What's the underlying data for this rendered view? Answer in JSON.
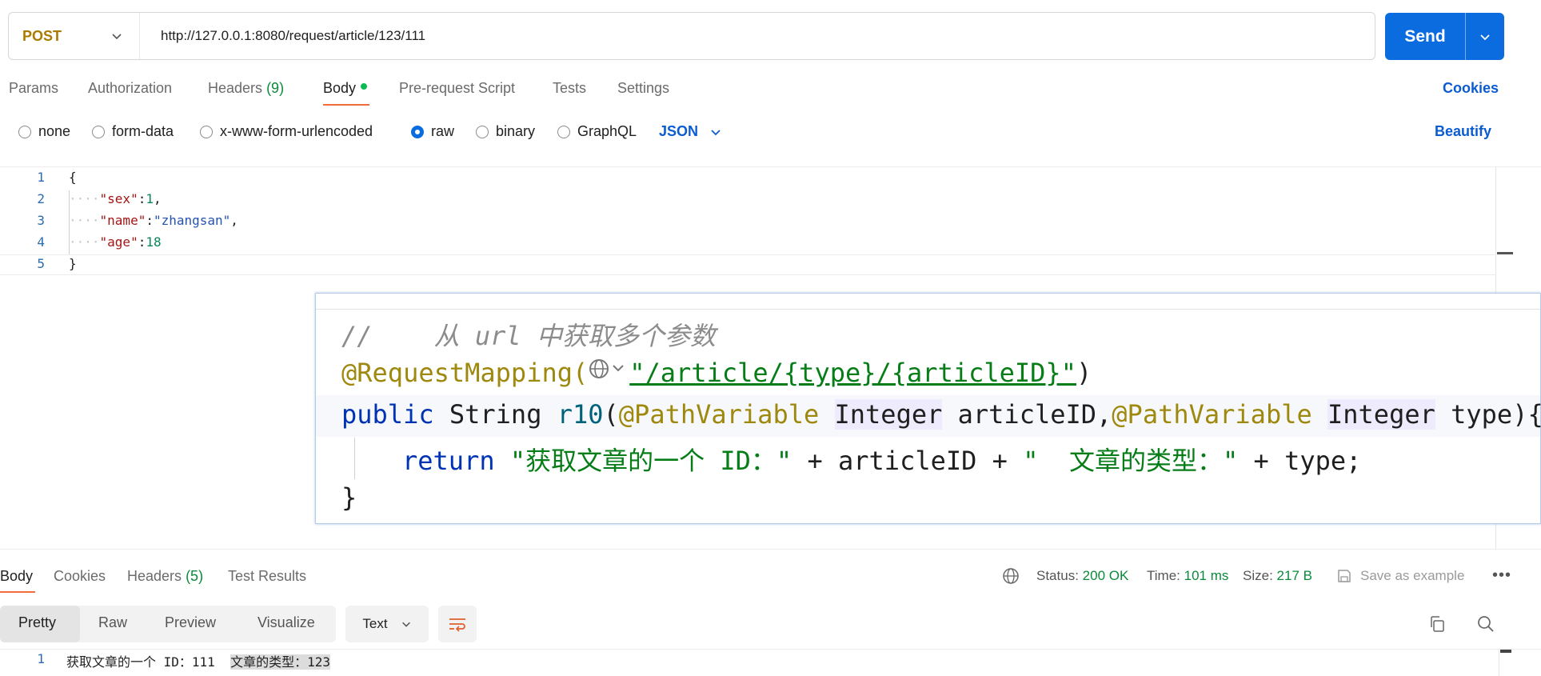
{
  "request": {
    "method": "POST",
    "url": "http://127.0.0.1:8080/request/article/123/111",
    "send_label": "Send"
  },
  "tabs": {
    "params": "Params",
    "authorization": "Authorization",
    "headers": "Headers",
    "headers_count": "(9)",
    "body": "Body",
    "prerequest": "Pre-request Script",
    "tests": "Tests",
    "settings": "Settings",
    "cookies": "Cookies"
  },
  "body_types": {
    "none": "none",
    "form_data": "form-data",
    "urlencoded": "x-www-form-urlencoded",
    "raw": "raw",
    "binary": "binary",
    "graphql": "GraphQL",
    "format": "JSON",
    "beautify": "Beautify"
  },
  "editor": {
    "line_numbers": [
      "1",
      "2",
      "3",
      "4",
      "5"
    ],
    "open_brace": "{",
    "close_brace": "}",
    "indent": "····",
    "sex_key": "\"sex\"",
    "sex_value": "1",
    "name_key": "\"name\"",
    "name_value": "\"zhangsan\"",
    "age_key": "\"age\"",
    "age_value": "18"
  },
  "overlay_code": {
    "comment": "//    从 url 中获取多个参数",
    "mapping_annotation": "@RequestMapping(",
    "mapping_path": "\"/article/{type}/{articleID}\"",
    "mapping_close": ")",
    "kw_public": "public",
    "type_string": "String",
    "method_name": "r10",
    "paren_open": "(",
    "pathvar1": "@PathVariable",
    "integer1": "Integer",
    "param1": "articleID,",
    "pathvar2": "@PathVariable",
    "integer2": "Integer",
    "param2": "type){",
    "kw_return": "return",
    "str1": "\"获取文章的一个 ID：\"",
    "plus_article": "+ articleID +",
    "str2": "\"  文章的类型：\"",
    "plus_type": "+ type;",
    "close_brace": "}"
  },
  "response": {
    "tab_body": "Body",
    "tab_cookies": "Cookies",
    "tab_headers": "Headers",
    "tab_headers_count": "(5)",
    "tab_test_results": "Test Results",
    "status_label": "Status:",
    "status_value": "200 OK",
    "time_label": "Time:",
    "time_value": "101 ms",
    "size_label": "Size:",
    "size_value": "217 B",
    "save_example": "Save as example",
    "view_pretty": "Pretty",
    "view_raw": "Raw",
    "view_preview": "Preview",
    "view_visualize": "Visualize",
    "text_format": "Text",
    "line_number": "1",
    "body_part1": "获取文章的一个 ID：111",
    "body_part2": "文章的类型：123"
  },
  "icons": {
    "method_dropdown": "chevron-down-icon",
    "send_dropdown": "chevron-down-icon",
    "globe": "globe-icon",
    "save": "save-icon",
    "more": "more-horizontal-icon",
    "wrap": "wrap-lines-icon",
    "copy": "copy-icon",
    "search": "search-icon"
  },
  "colors": {
    "accent": "#0b6ce0",
    "method": "#ab7a00",
    "status_ok": "#0a8a3a"
  }
}
